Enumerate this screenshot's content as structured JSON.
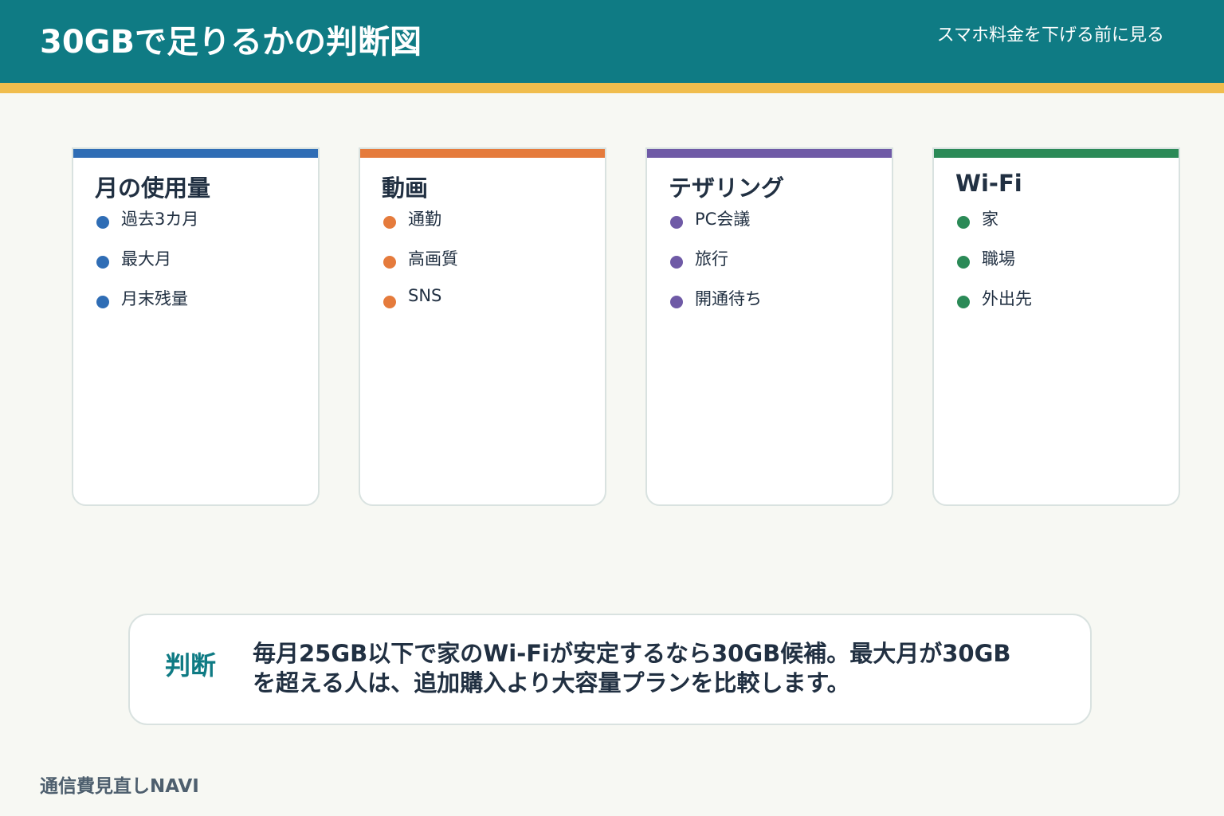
{
  "header": {
    "title": "30GBで足りるかの判断図",
    "subtitle": "スマホ料金を下げる前に見る"
  },
  "colors": {
    "header_bg": "#0f7b84",
    "header_stripe": "#f0bd4d",
    "page_bg": "#f7f8f3",
    "usage": "#2f6db5",
    "video": "#e57b3c",
    "tethering": "#6f5aa6",
    "wifi": "#2b8a57"
  },
  "cards": [
    {
      "title": "月の使用量",
      "color": "#2f6db5",
      "items": [
        "過去3カ月",
        "最大月",
        "月末残量"
      ]
    },
    {
      "title": "動画",
      "color": "#e57b3c",
      "items": [
        "通勤",
        "高画質",
        "SNS"
      ]
    },
    {
      "title": "テザリング",
      "color": "#6f5aa6",
      "items": [
        "PC会議",
        "旅行",
        "開通待ち"
      ]
    },
    {
      "title": "Wi-Fi",
      "color": "#2b8a57",
      "items": [
        "家",
        "職場",
        "外出先"
      ]
    }
  ],
  "judgment": {
    "label": "判断",
    "text": "毎月25GB以下で家のWi-Fiが安定するなら30GB候補。最大月が30GBを超える人は、追加購入より大容量プランを比較します。"
  },
  "footer": {
    "brand": "通信費見直しNAVI"
  }
}
